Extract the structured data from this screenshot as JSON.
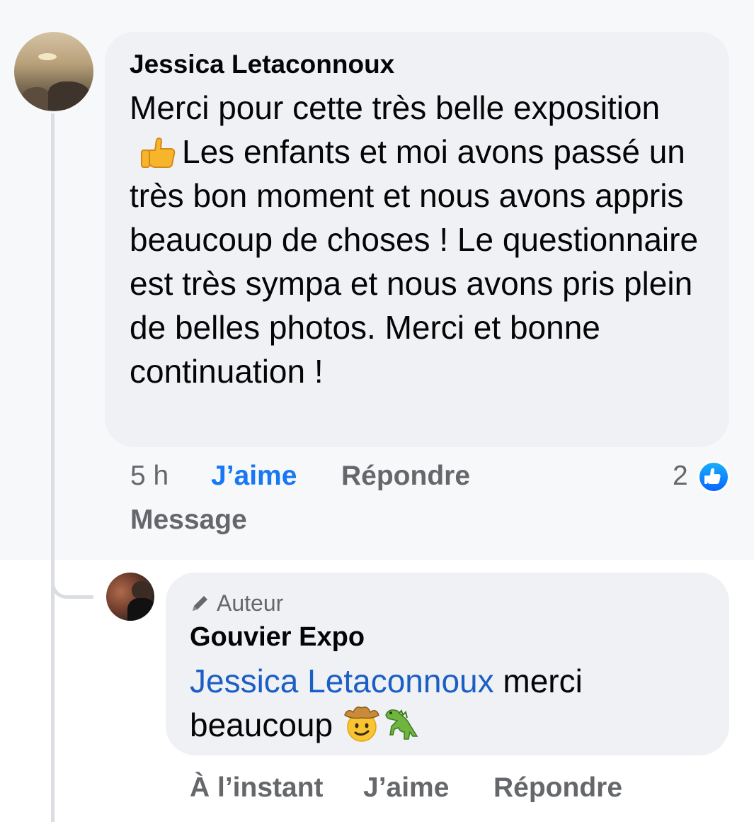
{
  "comment": {
    "author": "Jessica Letaconnoux",
    "text_before_emoji": "Merci pour cette très belle exposition",
    "emoji": "thumbs-up-icon",
    "text_after_emoji": "Les enfants et moi avons passé un très bon moment et nous avons appris beaucoup de choses ! Le questionnaire est très sympa et nous avons pris plein de belles photos. Merci et bonne continuation !",
    "time": "5 h",
    "like_label": "J’aime",
    "reply_label": "Répondre",
    "message_label": "Message",
    "reaction_count": "2",
    "reaction_icon": "like-reaction-icon",
    "like_active_color": "#1877f2"
  },
  "reply": {
    "badge_icon": "pencil-icon",
    "badge_label": "Auteur",
    "author": "Gouvier Expo",
    "mention": "Jessica Letaconnoux",
    "text": " merci beaucoup ",
    "emojis": [
      "cowboy-face-icon",
      "dinosaur-icon"
    ],
    "time": "À l’instant",
    "like_label": "J’aime",
    "reply_label": "Répondre"
  }
}
